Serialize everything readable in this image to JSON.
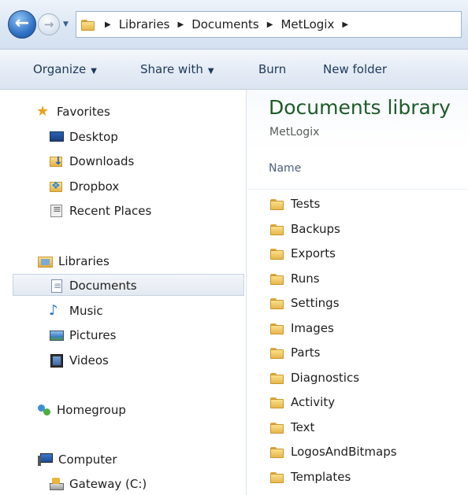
{
  "address_bar": {
    "breadcrumbs": [
      "Libraries",
      "Documents",
      "MetLogix"
    ]
  },
  "toolbar": {
    "organize": "Organize",
    "share_with": "Share with",
    "burn": "Burn",
    "new_folder": "New folder"
  },
  "nav": {
    "favorites": {
      "label": "Favorites",
      "items": [
        "Desktop",
        "Downloads",
        "Dropbox",
        "Recent Places"
      ]
    },
    "libraries": {
      "label": "Libraries",
      "items": [
        "Documents",
        "Music",
        "Pictures",
        "Videos"
      ],
      "selected": "Documents"
    },
    "homegroup": {
      "label": "Homegroup"
    },
    "computer": {
      "label": "Computer",
      "items": [
        "Gateway (C:)"
      ]
    }
  },
  "main": {
    "title": "Documents library",
    "subtitle": "MetLogix",
    "column_header": "Name",
    "folders": [
      "Tests",
      "Backups",
      "Exports",
      "Runs",
      "Settings",
      "Images",
      "Parts",
      "Diagnostics",
      "Activity",
      "Text",
      "LogosAndBitmaps",
      "Templates"
    ]
  },
  "colors": {
    "title_green": "#1e5a28",
    "command_text": "#1e395b",
    "folder_yellow": "#f2c85a"
  }
}
